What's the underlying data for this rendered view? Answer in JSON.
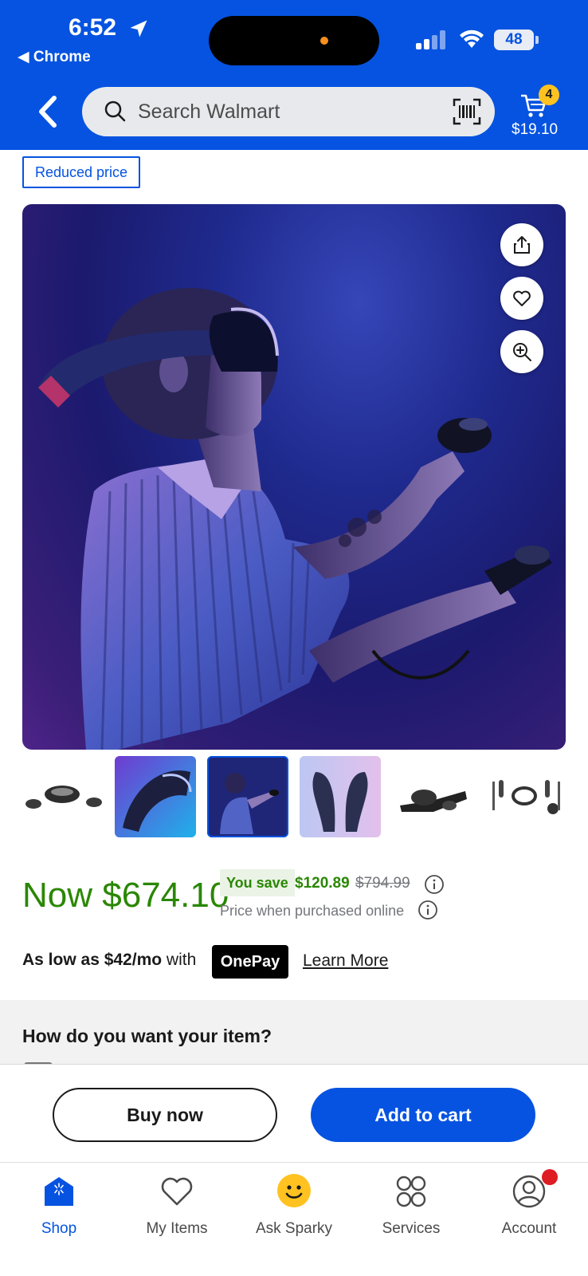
{
  "status_bar": {
    "time": "6:52",
    "back_app": "Chrome",
    "battery": "48"
  },
  "header": {
    "search_placeholder": "Search Walmart",
    "cart": {
      "count": "4",
      "total": "$19.10"
    }
  },
  "product": {
    "badge": "Reduced price",
    "image_actions": [
      "share-icon",
      "heart-icon",
      "zoom-icon"
    ],
    "thumbnail_count": 6,
    "selected_thumbnail_index": 2
  },
  "price": {
    "now": "Now $674.10",
    "you_save_label": "You save",
    "save_amount": "$120.89",
    "was_price": "$794.99",
    "online_note": "Price when purchased online"
  },
  "financing": {
    "prefix_bold": "As low as $42/mo",
    "suffix": " with",
    "provider": "OnePay",
    "link": "Learn More"
  },
  "fulfillment": {
    "title": "How do you want your item?"
  },
  "actions": {
    "buy_now": "Buy now",
    "add_to_cart": "Add to cart"
  },
  "bottom_nav": [
    {
      "label": "Shop",
      "icon": "shop-icon",
      "active": true
    },
    {
      "label": "My Items",
      "icon": "heart-icon",
      "active": false
    },
    {
      "label": "Ask Sparky",
      "icon": "sparky-icon",
      "active": false
    },
    {
      "label": "Services",
      "icon": "services-icon",
      "active": false
    },
    {
      "label": "Account",
      "icon": "account-icon",
      "active": false
    }
  ],
  "colors": {
    "brand_blue": "#0553e0",
    "price_green": "#2a8703",
    "cart_badge": "#ffc220",
    "notification_red": "#de1c24"
  }
}
